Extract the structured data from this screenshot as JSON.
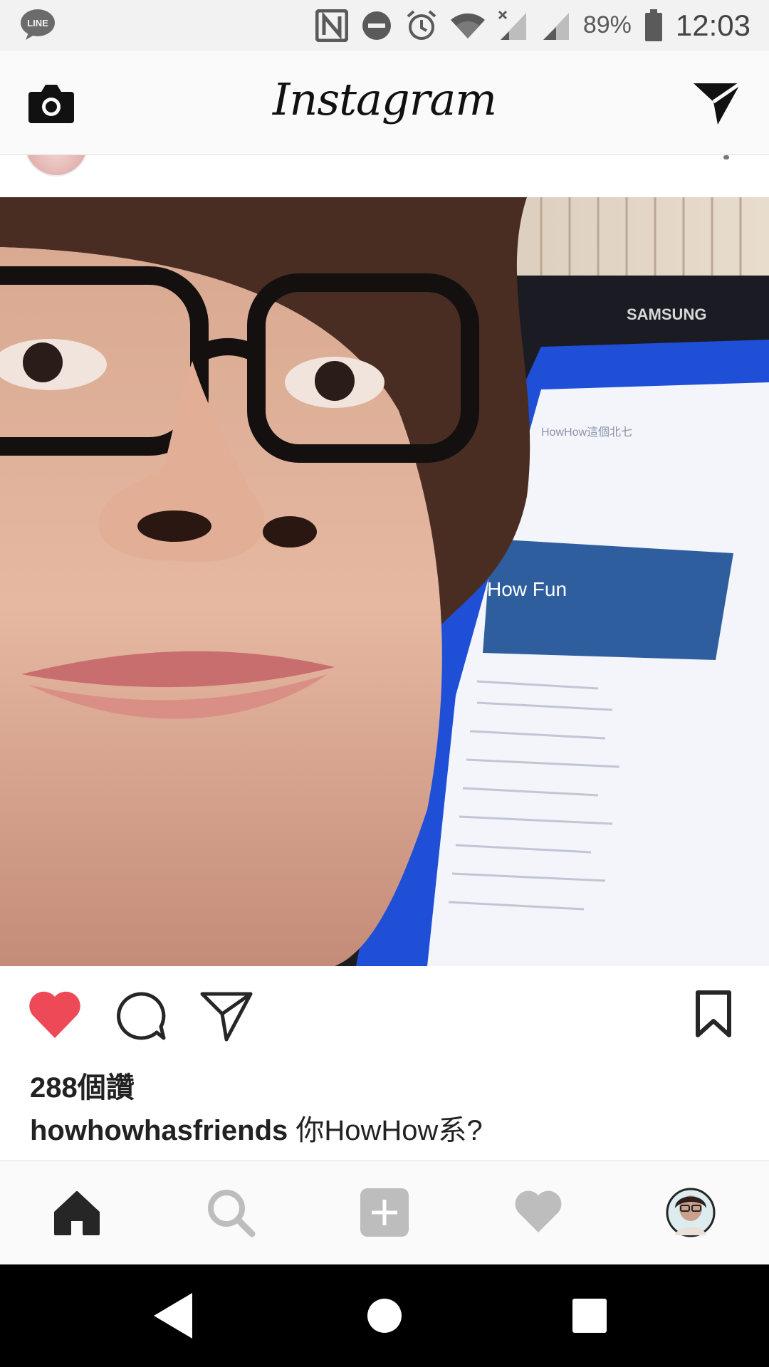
{
  "status_bar": {
    "notification_app": "LINE",
    "icons": [
      "nfc-icon",
      "do-not-disturb-icon",
      "alarm-icon",
      "wifi-icon",
      "signal-no-data-icon",
      "signal-icon",
      "battery-icon"
    ],
    "battery": "89%",
    "time": "12:03"
  },
  "top_bar": {
    "logo": "Instagram",
    "left_icon": "camera-icon",
    "right_icon": "direct-message-icon"
  },
  "post": {
    "image_text": {
      "brand": "SAMSUNG",
      "screen_banner": "How Fun",
      "screen_title": "HowHow這個北七"
    },
    "liked": true,
    "likes": "288個讚",
    "username": "howhowhasfriends",
    "caption": "你HowHow系?"
  },
  "colors": {
    "like_red": "#ed4956",
    "icon_dark": "#262626",
    "icon_grey": "#bdbdbd"
  },
  "bottom_nav": {
    "tabs": [
      "home-icon",
      "search-icon",
      "add-post-icon",
      "activity-heart-icon",
      "profile-avatar"
    ]
  },
  "system_nav": [
    "back-icon",
    "home-circle-icon",
    "recents-icon"
  ]
}
